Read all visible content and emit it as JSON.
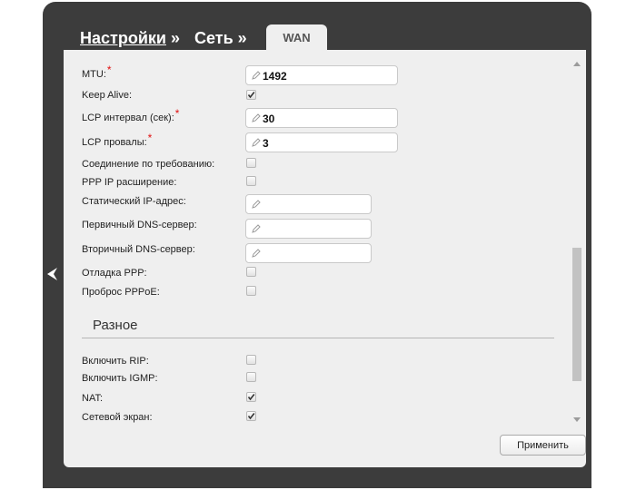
{
  "breadcrumb": {
    "settings": "Настройки",
    "sep1": "»",
    "network": "Сеть",
    "sep2": "»"
  },
  "tab": {
    "label": "WAN"
  },
  "fields": {
    "mtu": {
      "label": "MTU:",
      "required": "*",
      "value": "1492"
    },
    "keep_alive": {
      "label": "Keep Alive:",
      "checked": true
    },
    "lcp_interval": {
      "label": "LCP интервал (сек):",
      "required": "*",
      "value": "30"
    },
    "lcp_fails": {
      "label": "LCP провалы:",
      "required": "*",
      "value": "3"
    },
    "on_demand": {
      "label": "Соединение по требованию:",
      "checked": false
    },
    "ppp_ip_ext": {
      "label": "PPP IP расширение:",
      "checked": false
    },
    "static_ip": {
      "label": "Статический IP-адрес:",
      "value": ""
    },
    "primary_dns": {
      "label": "Первичный DNS-сервер:",
      "value": ""
    },
    "secondary_dns": {
      "label": "Вторичный DNS-сервер:",
      "value": ""
    },
    "ppp_debug": {
      "label": "Отладка PPP:",
      "checked": false
    },
    "pppoe_passthrough": {
      "label": "Проброс PPPoE:",
      "checked": false
    }
  },
  "misc": {
    "title": "Разное",
    "rip": {
      "label": "Включить RIP:",
      "checked": false
    },
    "igmp": {
      "label": "Включить IGMP:",
      "checked": false
    },
    "nat": {
      "label": "NAT:",
      "checked": true
    },
    "firewall": {
      "label": "Сетевой экран:",
      "checked": true
    }
  },
  "buttons": {
    "apply": "Применить"
  },
  "colors": {
    "frame": "#3c3c3c",
    "panel": "#efefef",
    "required": "#e01010"
  }
}
